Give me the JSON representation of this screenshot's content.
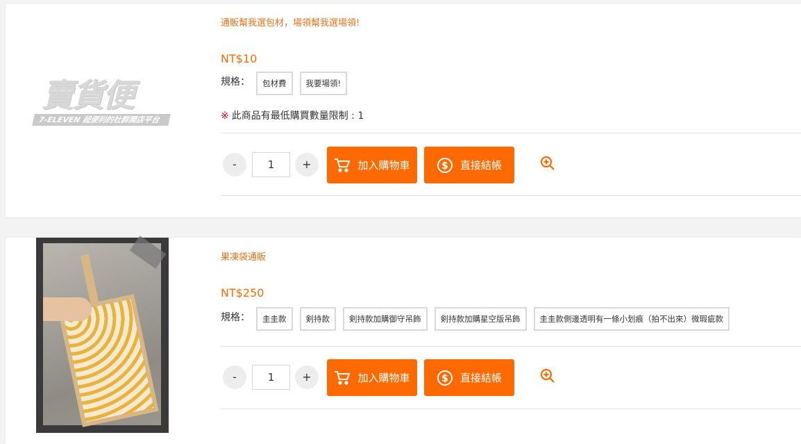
{
  "products": [
    {
      "name": "通販幫我選包材，場領幫我選場領!",
      "price": "NT$10",
      "spec_label": "規格：",
      "spec_options": [
        "包材費",
        "我要場領!"
      ],
      "limit_mark": "※",
      "limit_text": "此商品有最低購買數量限制 : 1",
      "qty_minus": "-",
      "qty_value": "1",
      "qty_plus": "+",
      "add_to_cart": "加入購物車",
      "checkout": "直接結帳",
      "logo_text": "賣貨便",
      "logo_sub": "7-ELEVEN 超便利的社群開店平台"
    },
    {
      "name": "果凍袋通販",
      "price": "NT$250",
      "spec_label": "規格：",
      "spec_options": [
        "圭圭款",
        "剣持款",
        "剣持款加購御守吊飾",
        "剣持款加購星空版吊飾",
        "圭圭款側邊透明有一條小划痕（拍不出來）微瑕疵款"
      ],
      "qty_minus": "-",
      "qty_value": "1",
      "qty_plus": "+",
      "add_to_cart": "加入購物車",
      "checkout": "直接結帳"
    }
  ],
  "colors": {
    "accent": "#ff6a00",
    "product_name": "#e8731c",
    "limit_mark": "#e60012"
  },
  "icons": {
    "cart": "cart-icon",
    "coin": "dollar-coin-icon",
    "zoom": "zoom-in-icon"
  }
}
